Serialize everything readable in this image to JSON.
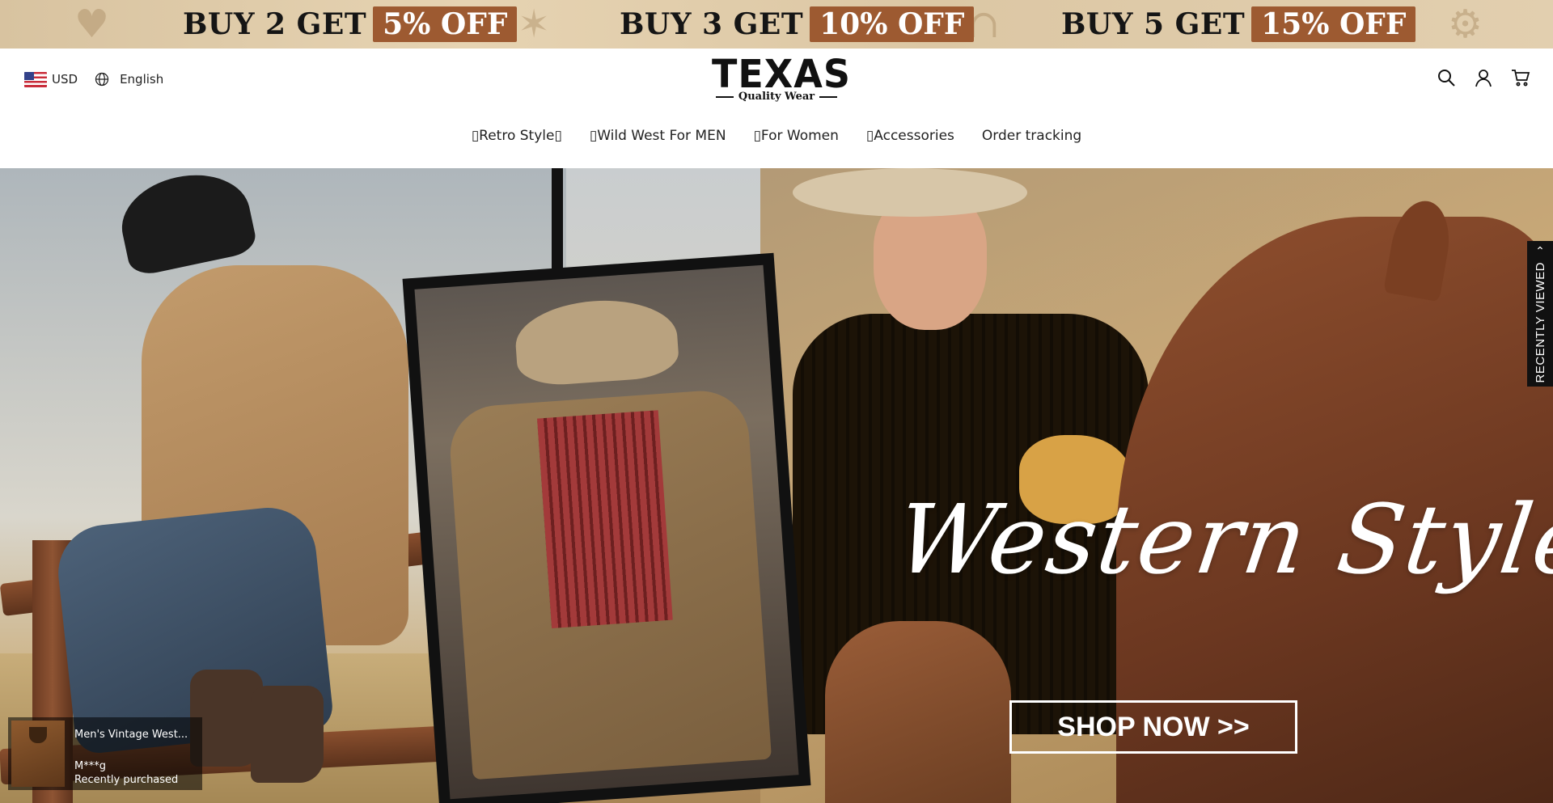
{
  "promo": {
    "items": [
      {
        "text": "BUY 2 GET",
        "badge": "5% OFF"
      },
      {
        "text": "BUY 3 GET",
        "badge": "10% OFF"
      },
      {
        "text": "BUY 5 GET",
        "badge": "15% OFF"
      }
    ]
  },
  "header": {
    "currency": "USD",
    "language": "English",
    "logo_main": "TEXAS",
    "logo_sub": "Quality Wear",
    "icons": [
      "search-icon",
      "account-icon",
      "cart-icon"
    ]
  },
  "nav": {
    "items": [
      {
        "label": "Retro Style"
      },
      {
        "label": "Wild West For MEN"
      },
      {
        "label": "For Women"
      },
      {
        "label": "Accessories"
      },
      {
        "label": "Order tracking"
      }
    ]
  },
  "hero": {
    "headline": "Western Style",
    "cta": "SHOP NOW >>"
  },
  "recently_viewed": {
    "label": "RECENTLY VIEWED"
  },
  "toast": {
    "product": "Men's Vintage West...",
    "user": "M***g",
    "status": "Recently purchased"
  },
  "colors": {
    "promo_badge": "#9d5a31",
    "promo_bg": "#dcc7a4",
    "tab_bg": "#111111"
  }
}
